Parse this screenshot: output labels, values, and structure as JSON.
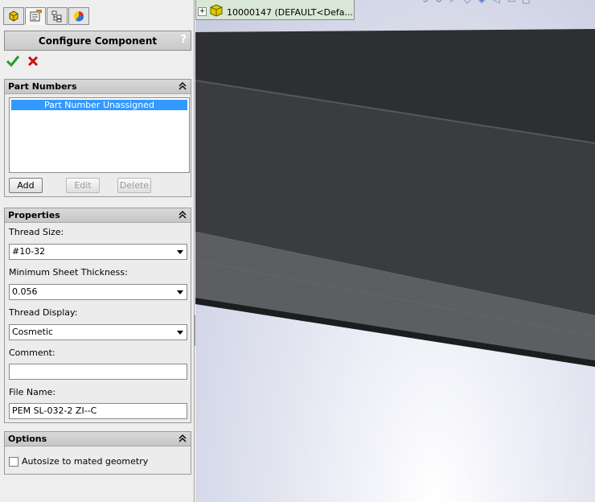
{
  "property_manager": {
    "tabs": [
      {
        "name": "feature-manager-icon",
        "active": false
      },
      {
        "name": "property-manager-icon",
        "active": true
      },
      {
        "name": "configuration-manager-icon",
        "active": false
      },
      {
        "name": "display-manager-icon",
        "active": false
      }
    ],
    "title": "Configure Component",
    "help_label": "?",
    "ok_icon": "checkmark-icon",
    "cancel_icon": "x-icon",
    "part_numbers": {
      "header": "Part Numbers",
      "items": [
        "Part Number Unassigned"
      ],
      "add_label": "Add",
      "edit_label": "Edit",
      "delete_label": "Delete"
    },
    "properties": {
      "header": "Properties",
      "thread_size_label": "Thread Size:",
      "thread_size_value": "#10-32",
      "min_sheet_label": "Minimum Sheet Thickness:",
      "min_sheet_value": "0.056",
      "thread_display_label": "Thread Display:",
      "thread_display_value": "Cosmetic",
      "comment_label": "Comment:",
      "comment_value": "",
      "file_name_label": "File Name:",
      "file_name_value": "PEM SL-032-2 ZI--C"
    },
    "options": {
      "header": "Options",
      "autosize_label": "Autosize to mated geometry",
      "autosize_checked": false
    }
  },
  "viewport": {
    "tree_item_text": "10000147  (DEFAULT<Defa...",
    "tree_expand": "+"
  },
  "colors": {
    "selection": "#3399ff",
    "ok_green": "#2a9a2a",
    "cancel_red": "#cc1111"
  }
}
